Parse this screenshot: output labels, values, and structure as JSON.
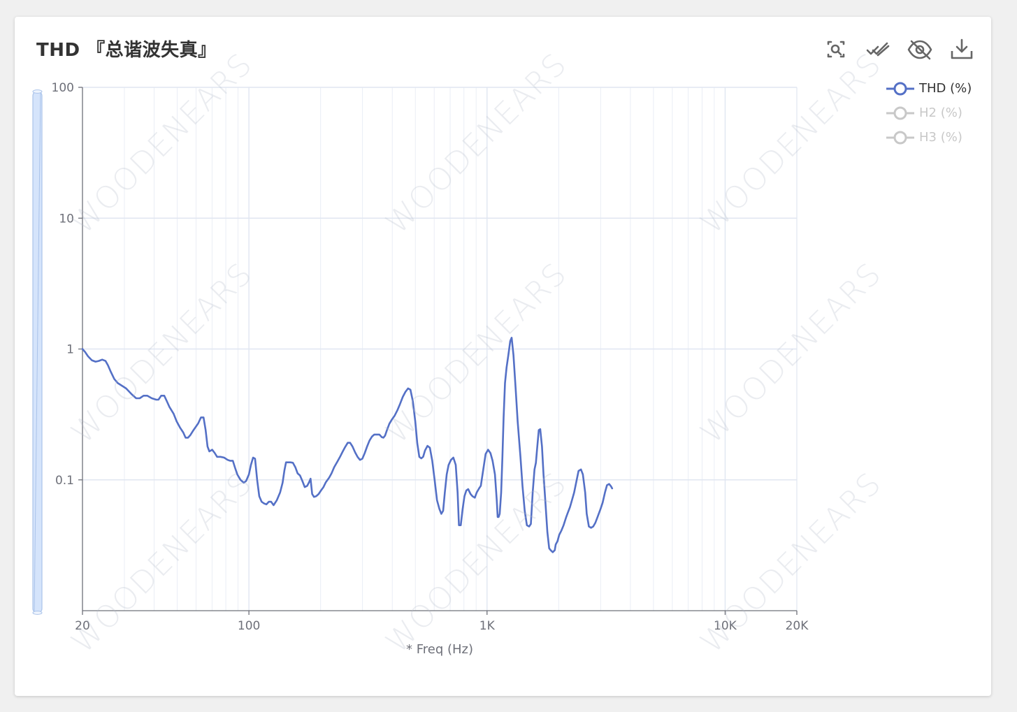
{
  "card": {
    "title": "THD 『总谐波失真』"
  },
  "toolbar": {
    "zoom_icon": "zoom-search-icon",
    "restore_icon": "double-check-icon",
    "hide_icon": "eye-off-icon",
    "download_icon": "download-icon"
  },
  "legend": {
    "items": [
      {
        "label": "THD (%)",
        "active": true,
        "color": "#5470c6"
      },
      {
        "label": "H2 (%)",
        "active": false,
        "color": "#c8c8c8"
      },
      {
        "label": "H3 (%)",
        "active": false,
        "color": "#c8c8c8"
      }
    ]
  },
  "watermark": "WOODENEARS",
  "colors": {
    "series": "#5470c6",
    "axis": "#6e7079",
    "grid": "#e0e6f1",
    "slider": "#c9dcfa"
  },
  "chart_data": {
    "type": "line",
    "x_scale": "log",
    "y_scale": "log",
    "xlim": [
      20,
      20000
    ],
    "ylim": [
      0.01,
      100
    ],
    "xlabel": "* Freq (Hz)",
    "ylabel": "",
    "grid": true,
    "legend_position": "top-right",
    "x_ticks": [
      {
        "value": 20,
        "label": "20"
      },
      {
        "value": 100,
        "label": "100"
      },
      {
        "value": 1000,
        "label": "1K"
      },
      {
        "value": 10000,
        "label": "10K"
      },
      {
        "value": 20000,
        "label": "20K"
      }
    ],
    "y_ticks": [
      {
        "value": 100,
        "label": "100"
      },
      {
        "value": 10,
        "label": "10"
      },
      {
        "value": 1,
        "label": "1"
      },
      {
        "value": 0.1,
        "label": "0.1"
      }
    ],
    "series": [
      {
        "name": "THD (%)",
        "visible": true,
        "points": [
          [
            20,
            1.0
          ],
          [
            20.5,
            0.95
          ],
          [
            21.1,
            0.88
          ],
          [
            21.9,
            0.82
          ],
          [
            22.7,
            0.8
          ],
          [
            23.4,
            0.81
          ],
          [
            24.2,
            0.83
          ],
          [
            25.0,
            0.81
          ],
          [
            25.6,
            0.75
          ],
          [
            26.3,
            0.67
          ],
          [
            27.2,
            0.59
          ],
          [
            28.1,
            0.55
          ],
          [
            29.0,
            0.53
          ],
          [
            30.5,
            0.5
          ],
          [
            32.2,
            0.45
          ],
          [
            33.6,
            0.42
          ],
          [
            34.8,
            0.42
          ],
          [
            36.1,
            0.44
          ],
          [
            37.4,
            0.44
          ],
          [
            39.1,
            0.42
          ],
          [
            40.8,
            0.41
          ],
          [
            41.7,
            0.41
          ],
          [
            42.8,
            0.44
          ],
          [
            44.1,
            0.44
          ],
          [
            45.2,
            0.4
          ],
          [
            46.4,
            0.36
          ],
          [
            48.3,
            0.32
          ],
          [
            49.7,
            0.28
          ],
          [
            51.4,
            0.25
          ],
          [
            53.0,
            0.23
          ],
          [
            54.2,
            0.21
          ],
          [
            55.5,
            0.21
          ],
          [
            56.8,
            0.22
          ],
          [
            58.5,
            0.24
          ],
          [
            61.2,
            0.27
          ],
          [
            62.9,
            0.3
          ],
          [
            64.5,
            0.3
          ],
          [
            65.8,
            0.24
          ],
          [
            67.0,
            0.18
          ],
          [
            68.2,
            0.165
          ],
          [
            70.1,
            0.17
          ],
          [
            71.9,
            0.16
          ],
          [
            73.5,
            0.15
          ],
          [
            76.0,
            0.15
          ],
          [
            78.6,
            0.148
          ],
          [
            81.4,
            0.142
          ],
          [
            83.3,
            0.14
          ],
          [
            85.6,
            0.14
          ],
          [
            87.3,
            0.125
          ],
          [
            89.4,
            0.11
          ],
          [
            92.2,
            0.1
          ],
          [
            95.2,
            0.095
          ],
          [
            97.3,
            0.098
          ],
          [
            100.0,
            0.11
          ],
          [
            102.0,
            0.13
          ],
          [
            104.1,
            0.148
          ],
          [
            106.1,
            0.145
          ],
          [
            108.3,
            0.1
          ],
          [
            110.5,
            0.075
          ],
          [
            113.1,
            0.068
          ],
          [
            115.7,
            0.066
          ],
          [
            118.4,
            0.065
          ],
          [
            121.2,
            0.068
          ],
          [
            124.0,
            0.068
          ],
          [
            126.9,
            0.064
          ],
          [
            131.0,
            0.07
          ],
          [
            135.2,
            0.08
          ],
          [
            138.5,
            0.095
          ],
          [
            141.0,
            0.118
          ],
          [
            143.2,
            0.136
          ],
          [
            146.0,
            0.136
          ],
          [
            149.4,
            0.136
          ],
          [
            153.0,
            0.135
          ],
          [
            156.6,
            0.125
          ],
          [
            160.2,
            0.112
          ],
          [
            163.9,
            0.108
          ],
          [
            167.7,
            0.098
          ],
          [
            171.6,
            0.088
          ],
          [
            175.7,
            0.09
          ],
          [
            178.9,
            0.096
          ],
          [
            181.5,
            0.102
          ],
          [
            184.3,
            0.078
          ],
          [
            187.6,
            0.074
          ],
          [
            191.9,
            0.075
          ],
          [
            196.3,
            0.078
          ],
          [
            200.9,
            0.083
          ],
          [
            205.6,
            0.088
          ],
          [
            210.4,
            0.096
          ],
          [
            217.3,
            0.104
          ],
          [
            222.3,
            0.112
          ],
          [
            228.1,
            0.125
          ],
          [
            235.3,
            0.138
          ],
          [
            241.4,
            0.15
          ],
          [
            247.0,
            0.163
          ],
          [
            253.4,
            0.178
          ],
          [
            260.0,
            0.192
          ],
          [
            266.1,
            0.192
          ],
          [
            272.3,
            0.18
          ],
          [
            279.4,
            0.162
          ],
          [
            285.9,
            0.15
          ],
          [
            292.6,
            0.142
          ],
          [
            299.5,
            0.145
          ],
          [
            306.5,
            0.16
          ],
          [
            313.6,
            0.18
          ],
          [
            321.0,
            0.2
          ],
          [
            328.5,
            0.214
          ],
          [
            336.2,
            0.222
          ],
          [
            344.0,
            0.222
          ],
          [
            353.0,
            0.222
          ],
          [
            361.3,
            0.212
          ],
          [
            367.0,
            0.21
          ],
          [
            373.0,
            0.218
          ],
          [
            379.9,
            0.24
          ],
          [
            388.7,
            0.268
          ],
          [
            399.0,
            0.29
          ],
          [
            409.4,
            0.31
          ],
          [
            420.2,
            0.34
          ],
          [
            431.2,
            0.38
          ],
          [
            442.5,
            0.43
          ],
          [
            454.1,
            0.47
          ],
          [
            466.0,
            0.5
          ],
          [
            476.9,
            0.488
          ],
          [
            488.0,
            0.4
          ],
          [
            499.4,
            0.28
          ],
          [
            509.6,
            0.19
          ],
          [
            519.6,
            0.15
          ],
          [
            529.5,
            0.146
          ],
          [
            539.2,
            0.15
          ],
          [
            549.2,
            0.168
          ],
          [
            562.1,
            0.182
          ],
          [
            575.2,
            0.176
          ],
          [
            588.6,
            0.14
          ],
          [
            602.4,
            0.1
          ],
          [
            616.5,
            0.07
          ],
          [
            630.8,
            0.06
          ],
          [
            642.7,
            0.055
          ],
          [
            654.4,
            0.058
          ],
          [
            664.9,
            0.08
          ],
          [
            677.1,
            0.11
          ],
          [
            689.5,
            0.13
          ],
          [
            705.6,
            0.142
          ],
          [
            722.1,
            0.148
          ],
          [
            738.9,
            0.13
          ],
          [
            752.5,
            0.08
          ],
          [
            762.3,
            0.045
          ],
          [
            775.8,
            0.045
          ],
          [
            789.7,
            0.06
          ],
          [
            804.1,
            0.075
          ],
          [
            818.6,
            0.083
          ],
          [
            833.4,
            0.085
          ],
          [
            852.9,
            0.078
          ],
          [
            868.5,
            0.075
          ],
          [
            888.8,
            0.073
          ],
          [
            904.7,
            0.08
          ],
          [
            926.0,
            0.086
          ],
          [
            941.9,
            0.09
          ],
          [
            964.2,
            0.12
          ],
          [
            986.4,
            0.158
          ],
          [
            1010.0,
            0.17
          ],
          [
            1033.6,
            0.16
          ],
          [
            1055.2,
            0.14
          ],
          [
            1079.5,
            0.11
          ],
          [
            1098.6,
            0.07
          ],
          [
            1108.3,
            0.052
          ],
          [
            1119.0,
            0.052
          ],
          [
            1130.0,
            0.055
          ],
          [
            1146.6,
            0.08
          ],
          [
            1160.1,
            0.15
          ],
          [
            1173.7,
            0.3
          ],
          [
            1189.7,
            0.55
          ],
          [
            1207.9,
            0.72
          ],
          [
            1229.2,
            0.9
          ],
          [
            1252.1,
            1.15
          ],
          [
            1268.6,
            1.22
          ],
          [
            1290.9,
            0.9
          ],
          [
            1318.9,
            0.5
          ],
          [
            1344.4,
            0.28
          ],
          [
            1381.4,
            0.15
          ],
          [
            1408.6,
            0.09
          ],
          [
            1439.5,
            0.058
          ],
          [
            1470.6,
            0.045
          ],
          [
            1502.0,
            0.044
          ],
          [
            1528.3,
            0.046
          ],
          [
            1554.6,
            0.08
          ],
          [
            1582.1,
            0.12
          ],
          [
            1604.2,
            0.135
          ],
          [
            1621.3,
            0.17
          ],
          [
            1649.5,
            0.24
          ],
          [
            1672.4,
            0.244
          ],
          [
            1701.6,
            0.18
          ],
          [
            1726.4,
            0.11
          ],
          [
            1756.7,
            0.07
          ],
          [
            1792.3,
            0.04
          ],
          [
            1824.1,
            0.03
          ],
          [
            1850.3,
            0.029
          ],
          [
            1888.0,
            0.028
          ],
          [
            1925.2,
            0.029
          ],
          [
            1941.9,
            0.032
          ],
          [
            1976.2,
            0.034
          ],
          [
            2009.8,
            0.038
          ],
          [
            2053.1,
            0.041
          ],
          [
            2097.1,
            0.045
          ],
          [
            2150.4,
            0.052
          ],
          [
            2183.2,
            0.056
          ],
          [
            2231.0,
            0.062
          ],
          [
            2273.0,
            0.07
          ],
          [
            2321.7,
            0.08
          ],
          [
            2380.2,
            0.1
          ],
          [
            2422.1,
            0.117
          ],
          [
            2480.3,
            0.12
          ],
          [
            2527.0,
            0.11
          ],
          [
            2583.3,
            0.08
          ],
          [
            2622.6,
            0.055
          ],
          [
            2678.3,
            0.044
          ],
          [
            2734.2,
            0.043
          ],
          [
            2791.5,
            0.044
          ],
          [
            2852.0,
            0.047
          ],
          [
            2911.9,
            0.052
          ],
          [
            2996.6,
            0.06
          ],
          [
            3059.2,
            0.067
          ],
          [
            3127.2,
            0.08
          ],
          [
            3189.6,
            0.091
          ],
          [
            3256.6,
            0.093
          ],
          [
            3318.6,
            0.089
          ],
          [
            3352.4,
            0.086
          ]
        ]
      },
      {
        "name": "H2 (%)",
        "visible": false,
        "points": []
      },
      {
        "name": "H3 (%)",
        "visible": false,
        "points": []
      }
    ]
  }
}
